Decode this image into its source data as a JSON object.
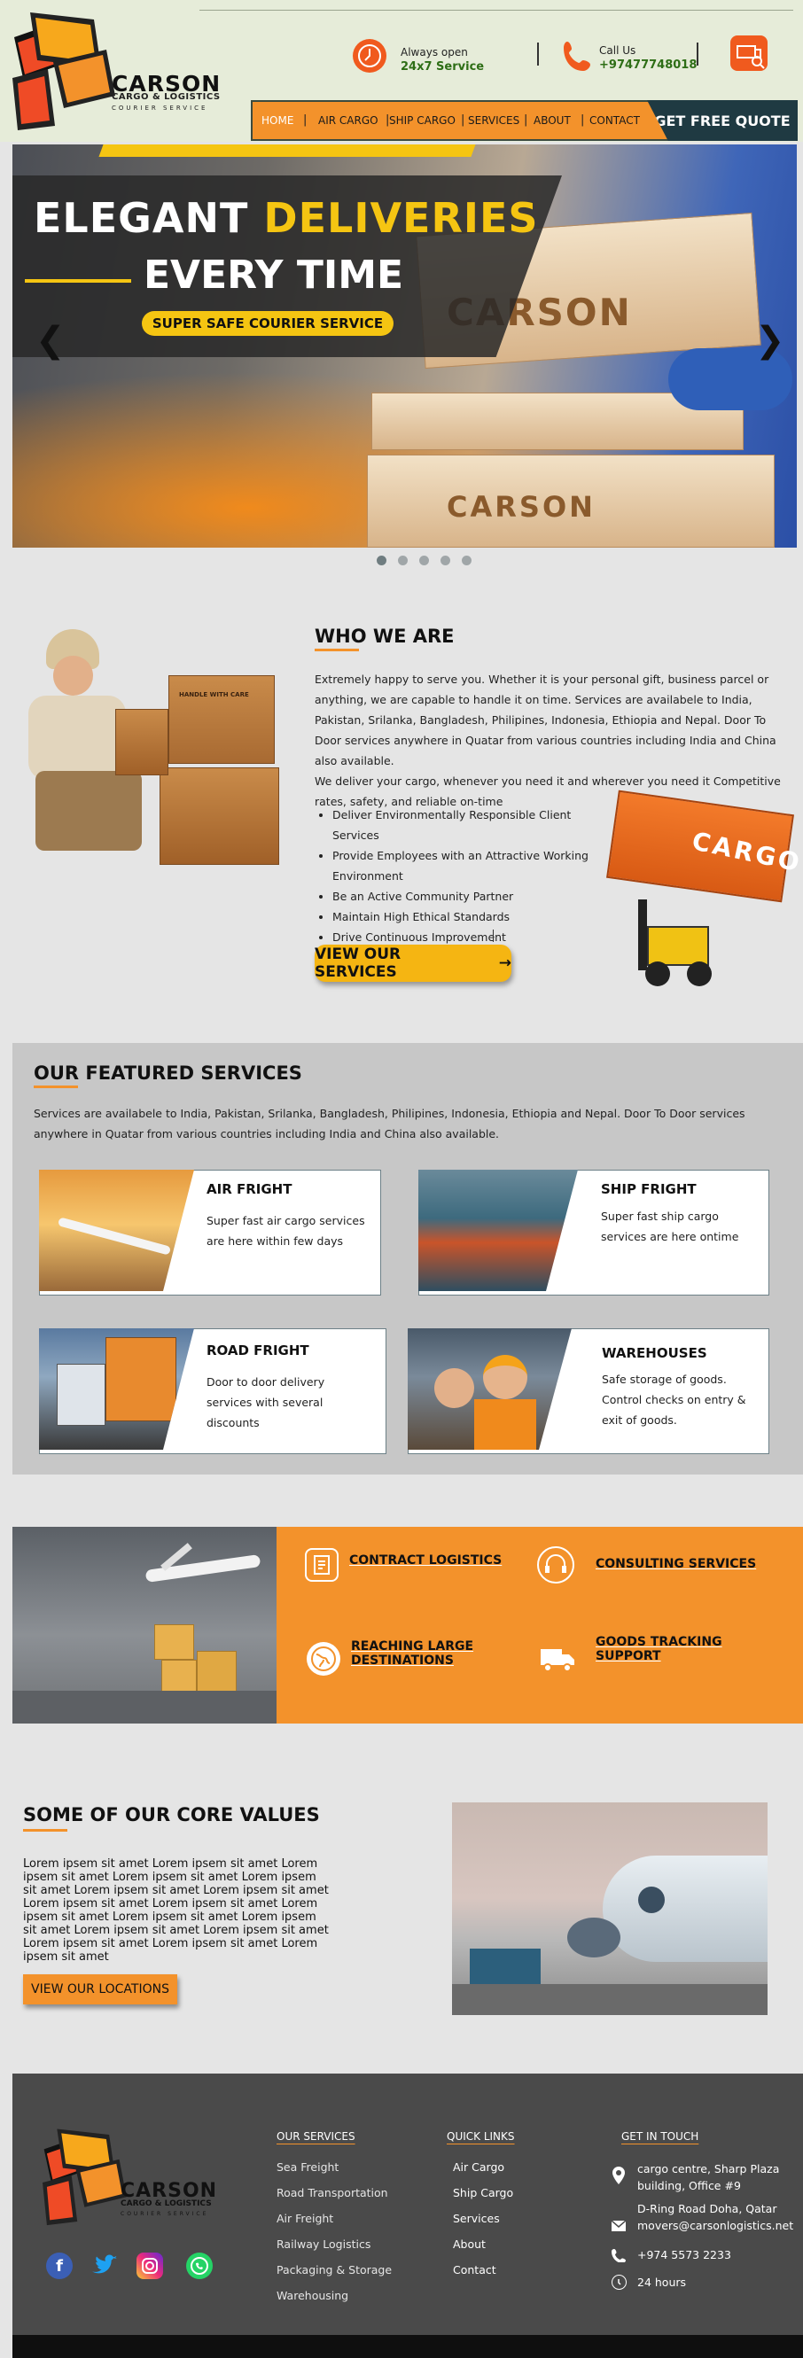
{
  "brand": {
    "name": "CARSON",
    "tagline": "CARGO & LOGISTICS",
    "sub": "COURIER SERVICE",
    "colors": {
      "orange": "#f3922b",
      "dark": "#1f3a42",
      "green": "#2e6e16"
    }
  },
  "header": {
    "open_label": "Always open",
    "open_value": "24x7 Service",
    "call_label": "Call Us",
    "call_value": "+97477748018",
    "icons": [
      "clock-icon",
      "phone-icon",
      "truck-search-icon"
    ]
  },
  "nav": {
    "items": [
      "HOME",
      "AIR CARGO",
      "SHIP CARGO",
      "SERVICES",
      "ABOUT",
      "CONTACT"
    ],
    "active": "HOME",
    "quote_button": "GET FREE QUOTE"
  },
  "hero": {
    "line1a": "ELEGANT",
    "line1b": "DELIVERIES",
    "line2": "EVERY TIME",
    "pill": "SUPER SAFE COURIER SERVICE",
    "box_brand": "CARSON",
    "prev": "❮",
    "next": "❯",
    "slides": 5,
    "active_slide": 1
  },
  "who": {
    "title": "WHO WE ARE",
    "paragraph1": "Extremely happy to serve you. Whether it is your personal gift, business parcel or anything, we are capable to handle it on time. Services are availabele to India, Pakistan, Srilanka, Bangladesh, Philipines, Indonesia, Ethiopia and Nepal. Door To Door services anywhere in Quatar from various countries including India and China also available.",
    "paragraph2": "We deliver your cargo, whenever you need it and wherever you need it Competitive rates, safety, and reliable on-time",
    "bullets": [
      "Deliver Environmentally Responsible Client Services",
      "Provide Employees with an Attractive Working Environment",
      "Be an Active Community Partner",
      "Maintain High Ethical Standards",
      "Drive Continuous Improvement"
    ],
    "box_label": "HANDLE WITH CARE",
    "container_label": "CARGO",
    "button": "VIEW OUR SERVICES",
    "button_arrow": "→"
  },
  "featured": {
    "title": "OUR FEATURED SERVICES",
    "intro": "Services are availabele to India, Pakistan, Srilanka, Bangladesh, Philipines, Indonesia, Ethiopia and Nepal. Door To Door services anywhere in Quatar from various countries including India and China also available.",
    "cards": [
      {
        "title": "AIR FRIGHT",
        "text": "Super fast air cargo services are here within few days"
      },
      {
        "title": "SHIP FRIGHT",
        "text": "Super fast ship cargo services are here ontime"
      },
      {
        "title": "ROAD FRIGHT",
        "text": "Door to door delivery services with several discounts"
      },
      {
        "title": "WAREHOUSES",
        "text": "Safe storage of goods. Control checks on entry & exit of goods."
      }
    ]
  },
  "band": {
    "items": [
      {
        "title": "CONTRACT LOGISTICS",
        "icon": "clipboard-icon"
      },
      {
        "title": "CONSULTING SERVICES",
        "icon": "headset-icon"
      },
      {
        "title": "REACHING LARGE DESTINATIONS",
        "icon": "globe-icon"
      },
      {
        "title": "GOODS TRACKING SUPPORT",
        "icon": "truck-icon"
      }
    ]
  },
  "values": {
    "title": "SOME OF OUR CORE VALUES",
    "text": "Lorem ipsem sit amet Lorem ipsem sit amet Lorem ipsem sit amet Lorem ipsem sit amet Lorem ipsem sit amet Lorem ipsem sit amet Lorem ipsem sit amet Lorem ipsem sit amet Lorem ipsem sit amet Lorem ipsem sit amet Lorem ipsem sit amet Lorem ipsem sit amet Lorem ipsem sit amet Lorem ipsem sit amet Lorem ipsem sit amet Lorem ipsem sit amet Lorem ipsem sit amet",
    "button": "VIEW OUR LOCATIONS"
  },
  "footer": {
    "services_head": "OUR SERVICES",
    "services": [
      "Sea Freight",
      "Road Transportation",
      "Air Freight",
      "Railway Logistics",
      "Packaging & Storage",
      "Warehousing"
    ],
    "quick_head": "QUICK LINKS",
    "quick": [
      "Air Cargo",
      "Ship Cargo",
      "Services",
      "About",
      "Contact"
    ],
    "touch_head": "GET IN TOUCH",
    "address1": "cargo centre, Sharp Plaza building, Office #9",
    "address2": "D-Ring Road Doha, Qatar",
    "email": "movers@carsonlogistics.net",
    "phone": "+974 5573 2233",
    "hours": "24 hours",
    "social": [
      "facebook-icon",
      "twitter-icon",
      "instagram-icon",
      "whatsapp-icon"
    ]
  }
}
